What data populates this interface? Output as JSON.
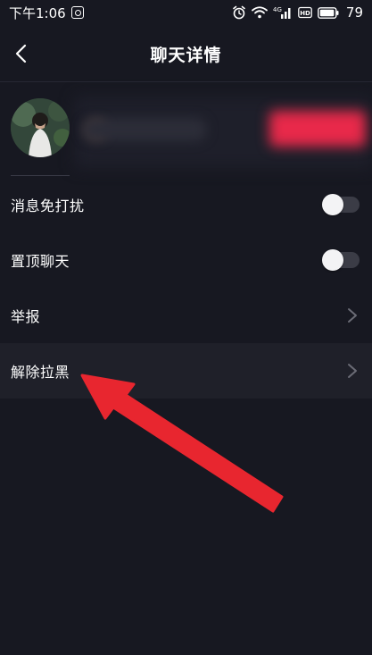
{
  "status_bar": {
    "time": "下午1:06",
    "network": "4G",
    "hd": "HD",
    "battery": "79"
  },
  "header": {
    "title": "聊天详情"
  },
  "settings": [
    {
      "label": "消息免打扰",
      "control": "toggle",
      "state": "off"
    },
    {
      "label": "置顶聊天",
      "control": "toggle",
      "state": "off"
    },
    {
      "label": "举报",
      "control": "chevron"
    },
    {
      "label": "解除拉黑",
      "control": "chevron",
      "highlighted": true
    }
  ],
  "icons": {
    "back": "chevron-left-icon",
    "alarm": "alarm-icon",
    "wifi": "wifi-icon",
    "signal": "signal-icon",
    "battery": "battery-icon",
    "chevron": "chevron-right-icon"
  },
  "colors": {
    "background": "#171821",
    "row_highlight": "#1f2029",
    "toggle_track": "#3b3c46",
    "chevron": "#6b6c76",
    "annotation_arrow": "#e8262f"
  }
}
